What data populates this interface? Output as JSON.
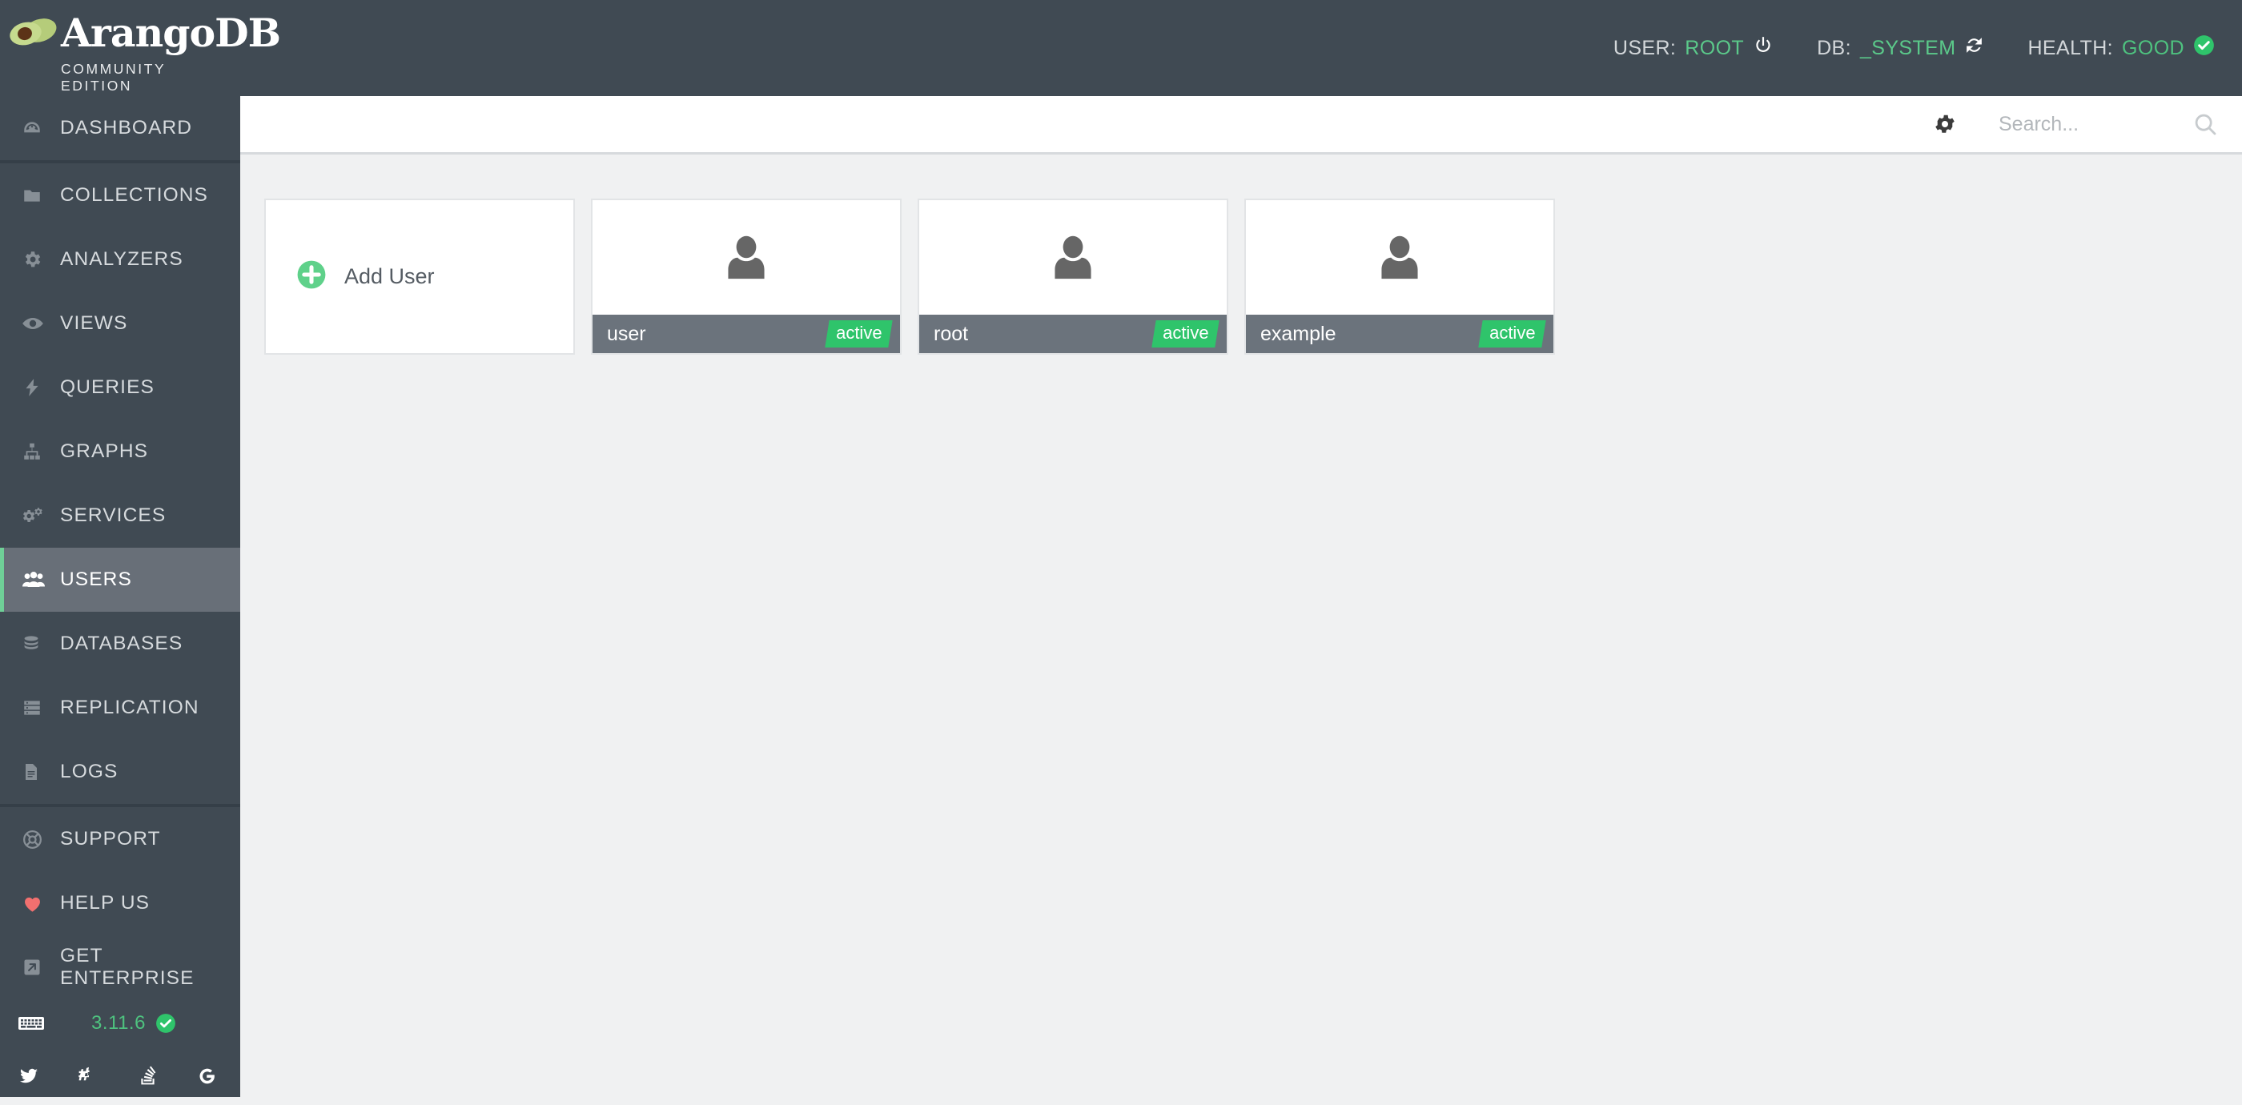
{
  "app": {
    "brand": "ArangoDB",
    "edition": "COMMUNITY EDITION",
    "logo_icon": "avocado-logo-icon"
  },
  "header": {
    "user_label": "USER:",
    "user_value": "ROOT",
    "user_icon": "power-icon",
    "db_label": "DB:",
    "db_value": "_SYSTEM",
    "db_icon": "refresh-icon",
    "health_label": "HEALTH:",
    "health_value": "GOOD",
    "health_icon": "check-circle-icon"
  },
  "sidebar": {
    "groups": [
      {
        "items": [
          {
            "label": "DASHBOARD",
            "icon": "gauge-icon",
            "active": false
          }
        ]
      },
      {
        "items": [
          {
            "label": "COLLECTIONS",
            "icon": "folder-icon",
            "active": false
          },
          {
            "label": "ANALYZERS",
            "icon": "gear-icon",
            "active": false
          },
          {
            "label": "VIEWS",
            "icon": "eye-icon",
            "active": false
          },
          {
            "label": "QUERIES",
            "icon": "bolt-icon",
            "active": false
          },
          {
            "label": "GRAPHS",
            "icon": "sitemap-icon",
            "active": false
          },
          {
            "label": "SERVICES",
            "icon": "cogs-icon",
            "active": false
          },
          {
            "label": "USERS",
            "icon": "users-icon",
            "active": true
          },
          {
            "label": "DATABASES",
            "icon": "database-icon",
            "active": false
          },
          {
            "label": "REPLICATION",
            "icon": "server-icon",
            "active": false
          },
          {
            "label": "LOGS",
            "icon": "file-text-icon",
            "active": false
          }
        ]
      },
      {
        "items": [
          {
            "label": "SUPPORT",
            "icon": "lifebuoy-icon",
            "active": false
          },
          {
            "label": "HELP US",
            "icon": "heart-icon",
            "active": false
          },
          {
            "label": "GET ENTERPRISE",
            "icon": "external-link-icon",
            "active": false
          }
        ]
      }
    ],
    "version": {
      "keyboard_icon": "keyboard-icon",
      "value": "3.11.6",
      "status_icon": "check-circle-icon"
    },
    "social": [
      {
        "name": "twitter-icon"
      },
      {
        "name": "slack-icon"
      },
      {
        "name": "stackoverflow-icon"
      },
      {
        "name": "google-icon"
      }
    ]
  },
  "toolbar": {
    "gear_icon": "gear-icon",
    "search_icon": "search-icon",
    "search_value": "",
    "search_placeholder": "Search..."
  },
  "users_view": {
    "add_card": {
      "label": "Add User",
      "icon": "plus-circle-icon"
    },
    "cards": [
      {
        "name": "user",
        "status": "active",
        "avatar_icon": "user-avatar-icon"
      },
      {
        "name": "root",
        "status": "active",
        "avatar_icon": "user-avatar-icon"
      },
      {
        "name": "example",
        "status": "active",
        "avatar_icon": "user-avatar-icon"
      }
    ]
  },
  "colors": {
    "sidebar_bg": "#404a53",
    "sidebar_active_bg": "#686f78",
    "accent_green": "#6fcf97",
    "badge_green": "#2fc46b",
    "card_footer": "#6b737c",
    "content_bg": "#f0f1f2",
    "heart_red": "#f2706f"
  }
}
